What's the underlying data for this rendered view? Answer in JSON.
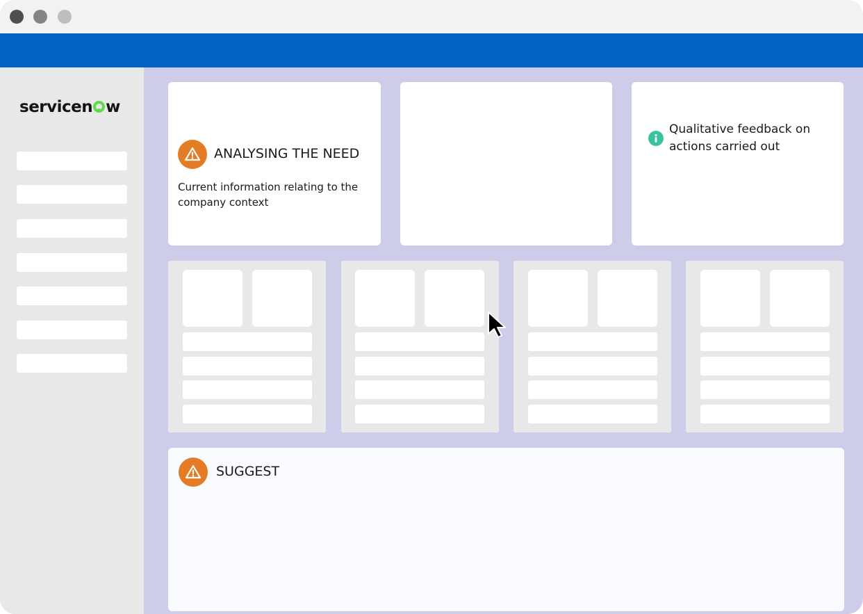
{
  "window": {
    "controls": [
      "close",
      "minimize",
      "zoom"
    ]
  },
  "brand": {
    "logo_text": "servicenow",
    "logo_color": "#62d84e"
  },
  "colors": {
    "header_blue": "#0263c4",
    "canvas": "#cdcde9",
    "sidebar": "#e8e8e8",
    "warning": "#e57c25",
    "info": "#3dc2a0"
  },
  "cards": {
    "analysing": {
      "title": "ANALYSING THE NEED",
      "body": "Current information relating to the company context",
      "icon": "warning-icon"
    },
    "feedback": {
      "text": "Qualitative feedback on actions carried out",
      "icon": "info-icon"
    },
    "suggest": {
      "title": "SUGGEST",
      "icon": "warning-icon"
    }
  }
}
